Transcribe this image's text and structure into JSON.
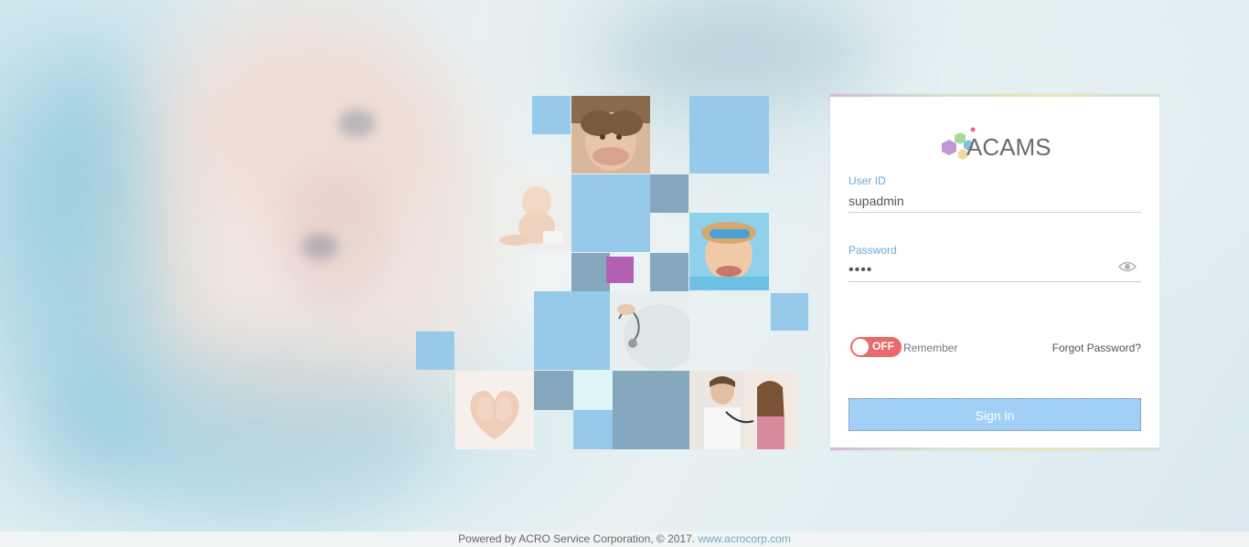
{
  "login": {
    "logo_text": "ACAMS",
    "user_id_label": "User ID",
    "user_id_value": "supadmin",
    "password_label": "Password",
    "password_value": "••••",
    "remember_toggle_state": "OFF",
    "remember_label": "Remember",
    "forgot_password": "Forgot Password?",
    "sign_in_label": "Sign in"
  },
  "footer": {
    "powered_by": "Powered by ACRO Service Corporation, © 2017.",
    "link_text": "www.acrocorp.com"
  },
  "colors": {
    "accent_blue": "#6aa6d8",
    "button_blue": "#a1cff6",
    "toggle_off": "#e86a6a",
    "tile_sky": "#96c9ea",
    "tile_slate": "#85a8bf",
    "tile_purple": "#b35fb3"
  },
  "icons": {
    "password_visibility": "eye-icon",
    "logo_mark": "hexagon-cluster-icon"
  }
}
